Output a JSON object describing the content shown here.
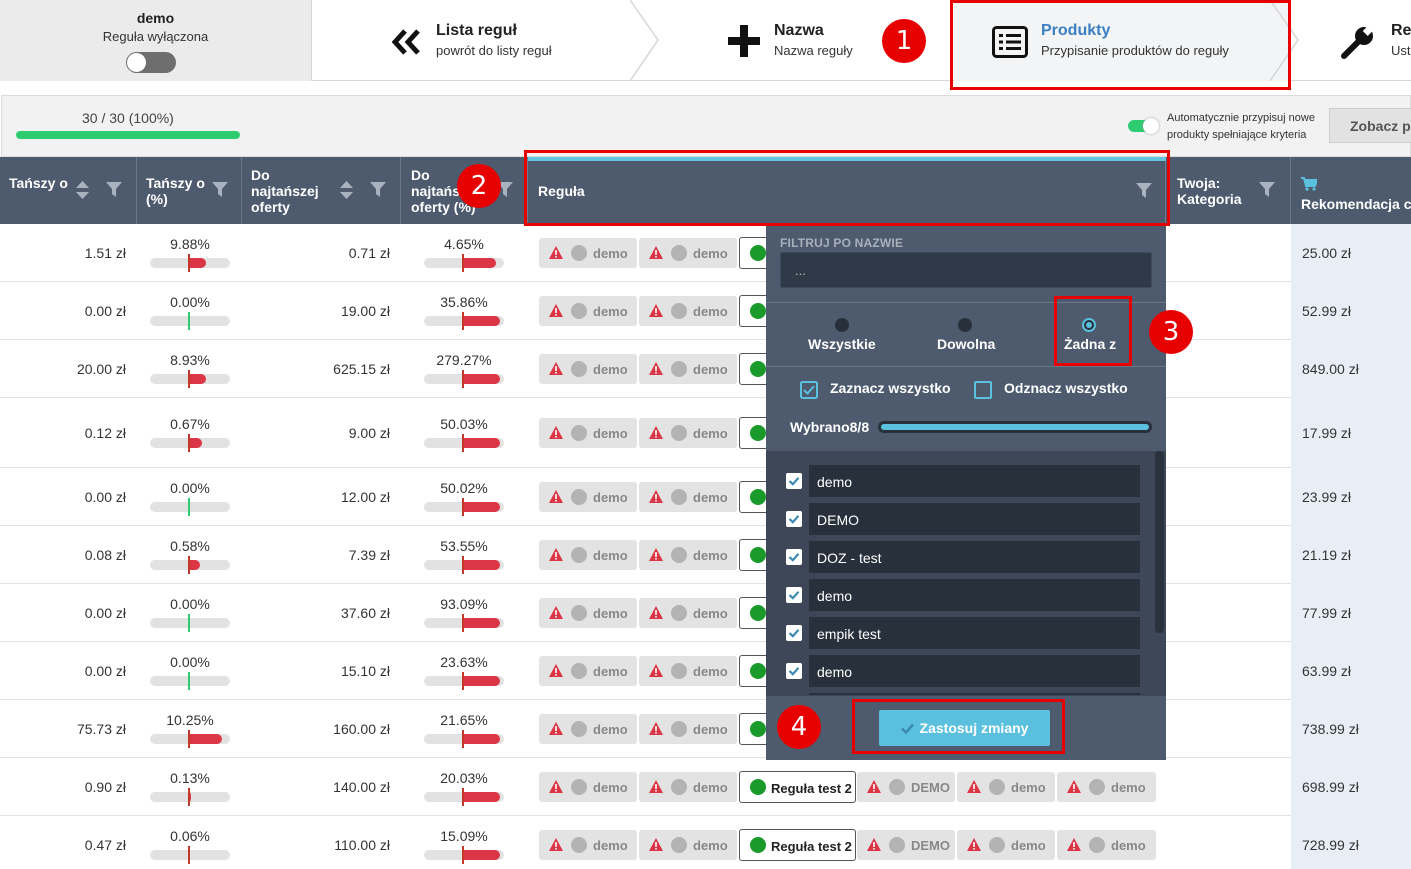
{
  "rule_status": {
    "name": "demo",
    "state": "Reguła wyłączona"
  },
  "steps": [
    {
      "title": "Lista reguł",
      "sub": "powrót do listy reguł",
      "icon": "double-chevron-left-icon"
    },
    {
      "title": "Nazwa",
      "sub": "Nazwa reguły",
      "icon": "plus-icon"
    },
    {
      "title": "Produkty",
      "sub": "Przypisanie produktów do reguły",
      "icon": "list-icon"
    },
    {
      "title": "Re",
      "sub": "Ust",
      "icon": "wrench-icon"
    }
  ],
  "markers": [
    "1",
    "2",
    "3",
    "4"
  ],
  "progress": {
    "text": "30 / 30 (100%)",
    "fraction": 1.0,
    "auto_assign": "Automatycznie przypisuj nowe produkty spełniające kryteria",
    "see_button": "Zobacz pr"
  },
  "columns": {
    "cheaper": "Tańszy o",
    "cheaper_pct": "Tańszy o (%)",
    "to_cheapest": "Do najtańszej oferty",
    "to_cheapest_pct": "Do najtańs oferty (%)",
    "rule": "Reguła",
    "category": "Twoja: Kategoria",
    "recommendation": "Rekomendacja c"
  },
  "rows": [
    {
      "cheaper": "1.51 zł",
      "cheaper_pct": "9.88%",
      "cheaper_fill": 0.45,
      "to_cheapest": "0.71 zł",
      "to_cheapest_pct": "4.65%",
      "tc_fill": 0.85,
      "reco": "25.00 zł"
    },
    {
      "cheaper": "0.00 zł",
      "cheaper_pct": "0.00%",
      "cheaper_fill": 0,
      "to_cheapest": "19.00 zł",
      "to_cheapest_pct": "35.86%",
      "tc_fill": 0.95,
      "reco": "52.99 zł"
    },
    {
      "cheaper": "20.00 zł",
      "cheaper_pct": "8.93%",
      "cheaper_fill": 0.45,
      "to_cheapest": "625.15 zł",
      "to_cheapest_pct": "279.27%",
      "tc_fill": 0.95,
      "reco": "849.00 zł"
    },
    {
      "cheaper": "0.12 zł",
      "cheaper_pct": "0.67%",
      "cheaper_fill": 0.35,
      "to_cheapest": "9.00 zł",
      "to_cheapest_pct": "50.03%",
      "tc_fill": 0.95,
      "reco": "17.99 zł"
    },
    {
      "cheaper": "0.00 zł",
      "cheaper_pct": "0.00%",
      "cheaper_fill": 0,
      "to_cheapest": "12.00 zł",
      "to_cheapest_pct": "50.02%",
      "tc_fill": 0.95,
      "reco": "23.99 zł"
    },
    {
      "cheaper": "0.08 zł",
      "cheaper_pct": "0.58%",
      "cheaper_fill": 0.3,
      "to_cheapest": "7.39 zł",
      "to_cheapest_pct": "53.55%",
      "tc_fill": 0.95,
      "reco": "21.19 zł"
    },
    {
      "cheaper": "0.00 zł",
      "cheaper_pct": "0.00%",
      "cheaper_fill": 0,
      "to_cheapest": "37.60 zł",
      "to_cheapest_pct": "93.09%",
      "tc_fill": 0.95,
      "reco": "77.99 zł"
    },
    {
      "cheaper": "0.00 zł",
      "cheaper_pct": "0.00%",
      "cheaper_fill": 0,
      "to_cheapest": "15.10 zł",
      "to_cheapest_pct": "23.63%",
      "tc_fill": 0.95,
      "reco": "63.99 zł"
    },
    {
      "cheaper": "75.73 zł",
      "cheaper_pct": "10.25%",
      "cheaper_fill": 0.85,
      "to_cheapest": "160.00 zł",
      "to_cheapest_pct": "21.65%",
      "tc_fill": 0.95,
      "reco": "738.99 zł"
    },
    {
      "cheaper": "0.90 zł",
      "cheaper_pct": "0.13%",
      "cheaper_fill": 0.08,
      "to_cheapest": "140.00 zł",
      "to_cheapest_pct": "20.03%",
      "tc_fill": 0.95,
      "reco": "698.99 zł"
    },
    {
      "cheaper": "0.47 zł",
      "cheaper_pct": "0.06%",
      "cheaper_fill": 0.05,
      "to_cheapest": "110.00 zł",
      "to_cheapest_pct": "15.09%",
      "tc_fill": 0.95,
      "reco": "728.99 zł"
    }
  ],
  "rule_chips": {
    "demo": "demo",
    "DEMO": "DEMO",
    "green": "Reguła test 2"
  },
  "filter": {
    "name_label": "FILTRUJ PO NAZWIE",
    "name_placeholder": "...",
    "modes": [
      "Wszystkie",
      "Dowolna",
      "Żadna z"
    ],
    "selected_mode": "Żadna z",
    "select_all": "Zaznacz wszystko",
    "deselect_all": "Odznacz wszystko",
    "selected_text": "Wybrano8/8",
    "selected_fraction": 1.0,
    "items": [
      "demo",
      "DEMO",
      "DOZ - test",
      "demo",
      "empik test",
      "demo"
    ],
    "apply": "Zastosuj zmiany"
  },
  "colors": {
    "accent": "#5bc0de",
    "header": "#4e5b6e",
    "highlight": "#e60000",
    "green": "#2ecc71",
    "red": "#dc3545"
  }
}
